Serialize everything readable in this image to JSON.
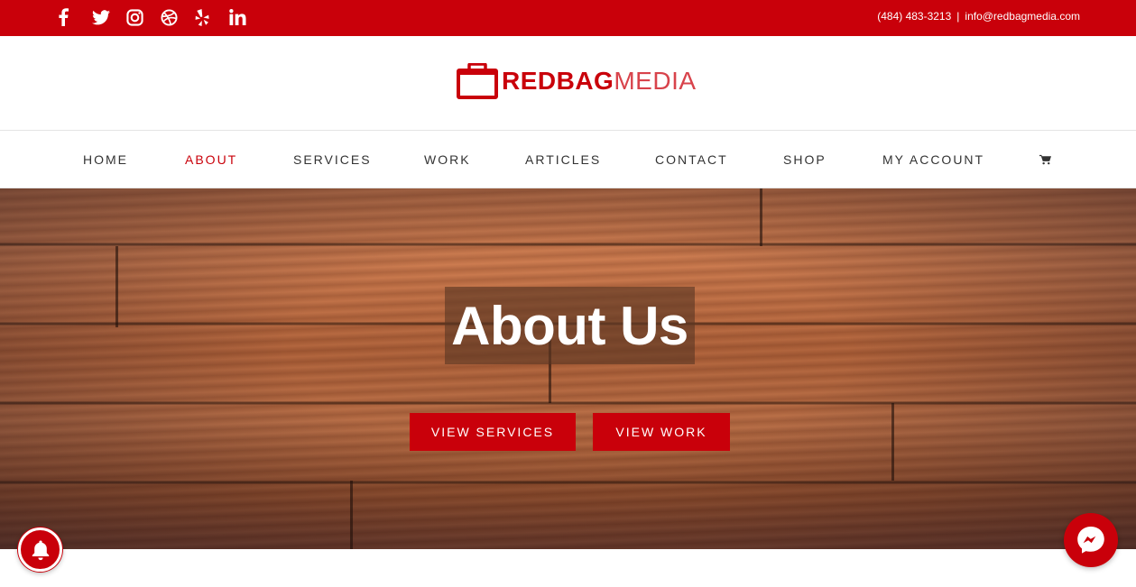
{
  "topbar": {
    "social_icons": [
      "facebook-icon",
      "twitter-icon",
      "instagram-icon",
      "dribbble-icon",
      "yelp-icon",
      "linkedin-icon"
    ],
    "phone": "(484) 483-3213",
    "separator": "|",
    "email": "info@redbagmedia.com"
  },
  "logo": {
    "bold": "REDBAG",
    "light": "MEDIA"
  },
  "nav": {
    "items": [
      {
        "label": "HOME"
      },
      {
        "label": "ABOUT"
      },
      {
        "label": "SERVICES"
      },
      {
        "label": "WORK"
      },
      {
        "label": "ARTICLES"
      },
      {
        "label": "CONTACT"
      },
      {
        "label": "SHOP"
      },
      {
        "label": "MY ACCOUNT"
      }
    ],
    "active": "ABOUT",
    "cart_icon": "cart-icon"
  },
  "hero": {
    "title": "About Us",
    "buttons": {
      "services": "VIEW SERVICES",
      "work": "VIEW WORK"
    }
  },
  "floating": {
    "notification_icon": "bell-icon",
    "chat_icon": "messenger-icon"
  },
  "colors": {
    "brand_red": "#c9000a",
    "nav_text": "#333333",
    "white": "#ffffff"
  }
}
